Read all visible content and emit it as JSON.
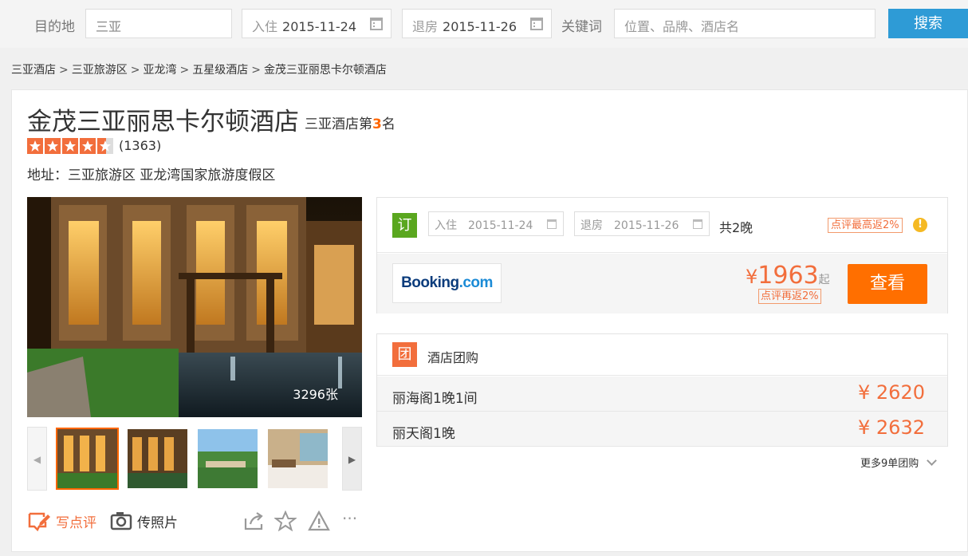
{
  "search": {
    "destination_label": "目的地",
    "destination_value": "三亚",
    "checkin_label": "入住",
    "checkin_value": "2015-11-24",
    "checkout_label": "退房",
    "checkout_value": "2015-11-26",
    "keyword_label": "关键词",
    "keyword_placeholder": "位置、品牌、酒店名",
    "search_button": "搜索"
  },
  "breadcrumb": [
    "三亚酒店",
    "三亚旅游区",
    "亚龙湾",
    "五星级酒店",
    "金茂三亚丽思卡尔顿酒店"
  ],
  "breadcrumb_separator": ">",
  "hotel": {
    "name": "金茂三亚丽思卡尔顿酒店",
    "rank_prefix": "三亚酒店第",
    "rank_number": "3",
    "rank_suffix": "名",
    "rating_stars": 4.5,
    "review_count": "(1363)",
    "address": "地址：三亚旅游区 亚龙湾国家旅游度假区",
    "photo_count": "3296张"
  },
  "actions": {
    "write_review": "写点评",
    "upload_photo": "传照片"
  },
  "booking": {
    "badge": "订",
    "checkin_label": "入住",
    "checkin_value": "2015-11-24",
    "checkout_label": "退房",
    "checkout_value": "2015-11-26",
    "nights": "共2晚",
    "rebate_tag": "点评最高返2%",
    "provider_name_main": "Booking",
    "provider_name_suffix": ".com",
    "currency": "¥",
    "price": "1963",
    "price_suffix": "起",
    "rebate2": "点评再返2%",
    "view_button": "查看"
  },
  "group_buy": {
    "badge": "团",
    "title": "酒店团购",
    "deals": [
      {
        "name": "丽海阁1晚1间",
        "price": "¥ 2620"
      },
      {
        "name": "丽天阁1晚",
        "price": "¥ 2632"
      }
    ],
    "more": "更多9单团购"
  },
  "colors": {
    "accent_orange": "#ff6f00",
    "price_orange": "#f26e3c",
    "search_blue": "#2e9bd6",
    "book_green": "#5aa71f",
    "group_red": "#f26e3c"
  }
}
